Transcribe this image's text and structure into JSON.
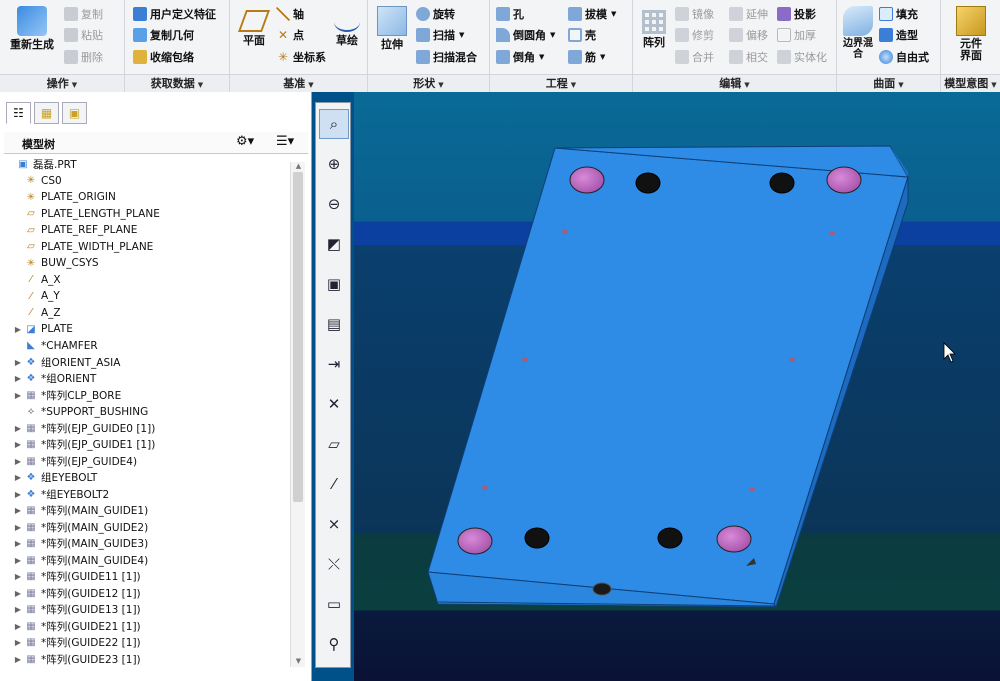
{
  "ribbon": {
    "groups": [
      {
        "caption": "操作"
      },
      {
        "caption": "获取数据"
      },
      {
        "caption": "基准"
      },
      {
        "caption": "形状"
      },
      {
        "caption": "工程"
      },
      {
        "caption": "编辑"
      },
      {
        "caption": "曲面"
      },
      {
        "caption": "模型意图"
      }
    ],
    "ops": {
      "regen": "重新生成",
      "copy": "复制",
      "paste": "粘贴",
      "delete": "删除"
    },
    "getdata": {
      "udf": "用户定义特征",
      "copygeom": "复制几何",
      "shrinkwrap": "收缩包络"
    },
    "datum": {
      "plane": "平面",
      "axis": "轴",
      "point": "点",
      "csys": "坐标系",
      "sketch": "草绘"
    },
    "shapes": {
      "extrude": "拉伸",
      "revolve": "旋转",
      "sweep": "扫描",
      "swept_blend": "扫描混合"
    },
    "eng": {
      "hole": "孔",
      "round": "倒圆角",
      "chamfer": "倒角",
      "draft": "拔模",
      "shell": "壳",
      "rib": "筋"
    },
    "edit": {
      "pattern": "阵列",
      "mirror": "镜像",
      "trim": "修剪",
      "merge": "合并",
      "extend": "延伸",
      "offset": "偏移",
      "intersect": "相交",
      "project": "投影",
      "thicken": "加厚",
      "solidify": "实体化"
    },
    "surfaces": {
      "boundary": "边界混合",
      "fill": "填充",
      "style": "造型",
      "freeform": "自由式"
    },
    "intent": {
      "component_interface": "元件界面"
    }
  },
  "sidebar": {
    "tree_title": "模型树",
    "items": [
      {
        "label": "磊磊.PRT",
        "expand": "",
        "icon": "part-icon"
      },
      {
        "label": "CS0",
        "expand": "",
        "icon": "csys-icon"
      },
      {
        "label": "PLATE_ORIGIN",
        "expand": "",
        "icon": "csys-icon"
      },
      {
        "label": "PLATE_LENGTH_PLANE",
        "expand": "",
        "icon": "plane-icon"
      },
      {
        "label": "PLATE_REF_PLANE",
        "expand": "",
        "icon": "plane-icon"
      },
      {
        "label": "PLATE_WIDTH_PLANE",
        "expand": "",
        "icon": "plane-icon"
      },
      {
        "label": "BUW_CSYS",
        "expand": "",
        "icon": "csys-icon"
      },
      {
        "label": "A_X",
        "expand": "",
        "icon": "axis-icon"
      },
      {
        "label": "A_Y",
        "expand": "",
        "icon": "axis-icon"
      },
      {
        "label": "A_Z",
        "expand": "",
        "icon": "axis-icon"
      },
      {
        "label": "PLATE",
        "expand": "▶",
        "icon": "extrude-icon"
      },
      {
        "label": "*CHAMFER",
        "expand": "",
        "icon": "chamfer-icon"
      },
      {
        "label": "组ORIENT_ASIA",
        "expand": "▶",
        "icon": "group-icon"
      },
      {
        "label": "*组ORIENT",
        "expand": "▶",
        "icon": "group-icon"
      },
      {
        "label": "*阵列CLP_BORE",
        "expand": "▶",
        "icon": "pattern-icon"
      },
      {
        "label": "*SUPPORT_BUSHING",
        "expand": "",
        "icon": "bushing-icon"
      },
      {
        "label": "*阵列(EJP_GUIDE0 [1])",
        "expand": "▶",
        "icon": "pattern-icon"
      },
      {
        "label": "*阵列(EJP_GUIDE1 [1])",
        "expand": "▶",
        "icon": "pattern-icon"
      },
      {
        "label": "*阵列(EJP_GUIDE4)",
        "expand": "▶",
        "icon": "pattern-icon"
      },
      {
        "label": "组EYEBOLT",
        "expand": "▶",
        "icon": "group-icon"
      },
      {
        "label": "*组EYEBOLT2",
        "expand": "▶",
        "icon": "group-icon"
      },
      {
        "label": "*阵列(MAIN_GUIDE1)",
        "expand": "▶",
        "icon": "pattern-icon"
      },
      {
        "label": "*阵列(MAIN_GUIDE2)",
        "expand": "▶",
        "icon": "pattern-icon"
      },
      {
        "label": "*阵列(MAIN_GUIDE3)",
        "expand": "▶",
        "icon": "pattern-icon"
      },
      {
        "label": "*阵列(MAIN_GUIDE4)",
        "expand": "▶",
        "icon": "pattern-icon"
      },
      {
        "label": "*阵列(GUIDE11 [1])",
        "expand": "▶",
        "icon": "pattern-icon"
      },
      {
        "label": "*阵列(GUIDE12 [1])",
        "expand": "▶",
        "icon": "pattern-icon"
      },
      {
        "label": "*阵列(GUIDE13 [1])",
        "expand": "▶",
        "icon": "pattern-icon"
      },
      {
        "label": "*阵列(GUIDE21 [1])",
        "expand": "▶",
        "icon": "pattern-icon"
      },
      {
        "label": "*阵列(GUIDE22 [1])",
        "expand": "▶",
        "icon": "pattern-icon"
      },
      {
        "label": "*阵列(GUIDE23 [1])",
        "expand": "▶",
        "icon": "pattern-icon"
      }
    ]
  },
  "viewtools": [
    {
      "icon": "zoom-fit-icon",
      "glyph": "⌕"
    },
    {
      "icon": "zoom-in-icon",
      "glyph": "⊕"
    },
    {
      "icon": "zoom-out-icon",
      "glyph": "⊖"
    },
    {
      "icon": "repaint-icon",
      "glyph": "◩"
    },
    {
      "icon": "display-style-icon",
      "glyph": "▣"
    },
    {
      "icon": "saved-views-icon",
      "glyph": "▤"
    },
    {
      "icon": "view-manager-icon",
      "glyph": "⇥"
    },
    {
      "icon": "datum-display-icon",
      "glyph": "✕"
    },
    {
      "icon": "plane-display-icon",
      "glyph": "▱"
    },
    {
      "icon": "axis-display-icon",
      "glyph": "⁄"
    },
    {
      "icon": "point-display-icon",
      "glyph": "⨯"
    },
    {
      "icon": "csys-display-icon",
      "glyph": "⤬"
    },
    {
      "icon": "annotation-display-icon",
      "glyph": "▭"
    },
    {
      "icon": "spin-center-icon",
      "glyph": "⚲"
    }
  ],
  "colors": {
    "plate": "#2e8ce6",
    "plate_side": "#1f6fc4",
    "hole_pink": "#c06bc0",
    "hole_dark": "#111111",
    "band_blue": "#0b3fa0"
  }
}
